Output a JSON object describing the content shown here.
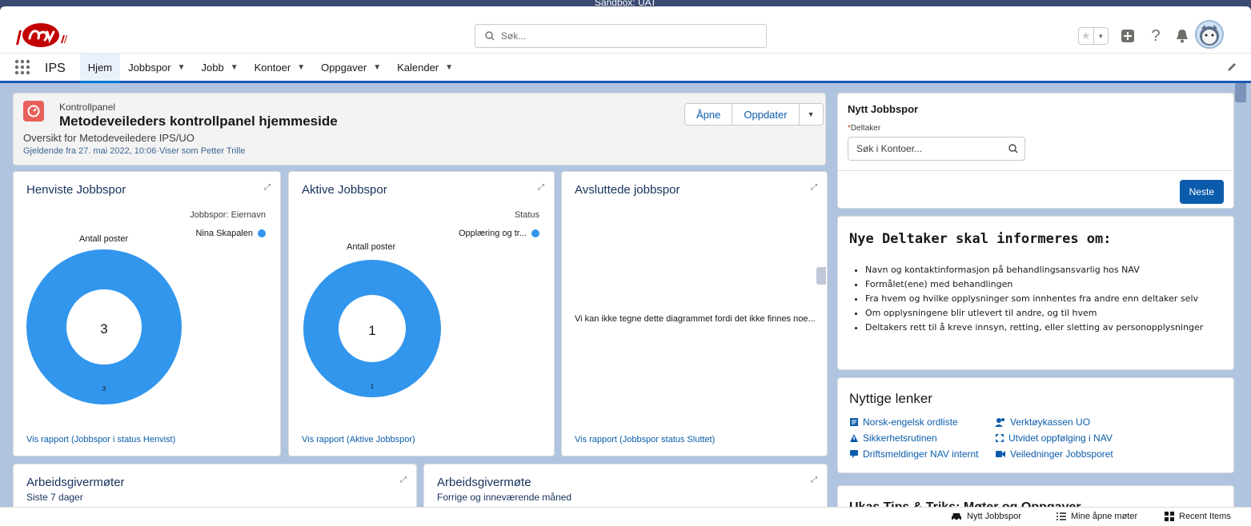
{
  "sandbox": {
    "label": "Sandbox: UAT"
  },
  "header": {
    "search_placeholder": "Søk...",
    "help_label": "?"
  },
  "nav": {
    "app_name": "IPS",
    "items": [
      {
        "label": "Hjem",
        "active": true,
        "chevron": false
      },
      {
        "label": "Jobbspor",
        "active": false,
        "chevron": true
      },
      {
        "label": "Jobb",
        "active": false,
        "chevron": true
      },
      {
        "label": "Kontoer",
        "active": false,
        "chevron": true
      },
      {
        "label": "Oppgaver",
        "active": false,
        "chevron": true
      },
      {
        "label": "Kalender",
        "active": false,
        "chevron": true
      }
    ]
  },
  "dashboard": {
    "kicker": "Kontrollpanel",
    "title": "Metodeveileders kontrollpanel hjemmeside",
    "subtitle": "Oversikt for Metodeveiledere IPS/UO",
    "date_info": "Gjeldende fra 27. mai 2022, 10:06·Viser som Petter Trille",
    "btn_open": "Åpne",
    "btn_update": "Oppdater"
  },
  "widgets": {
    "henviste": {
      "title": "Henviste Jobbspor",
      "legend_header": "Jobbspor: Eiernavn",
      "legend_item": "Nina Skapalen",
      "antall": "Antall poster",
      "center_value": "3",
      "segment_label": "3",
      "link": "Vis rapport (Jobbspor i status Henvist)"
    },
    "aktive": {
      "title": "Aktive Jobbspor",
      "legend_header": "Status",
      "legend_item": "Opplæring og tr...",
      "antall": "Antall poster",
      "center_value": "1",
      "segment_label": "1",
      "link": "Vis rapport (Aktive Jobbspor)"
    },
    "avsluttede": {
      "title": "Avsluttede jobbspor",
      "empty_msg": "Vi kan ikke tegne dette diagrammet fordi det ikke finnes noe...",
      "link": "Vis rapport (Jobbspor status Sluttet)"
    },
    "arbeidsgivermoter": {
      "title": "Arbeidsgivermøter",
      "subtitle": "Siste 7 dager"
    },
    "arbeidsgivermote": {
      "title": "Arbeidsgivermøte",
      "subtitle": "Forrige og inneværende måned"
    }
  },
  "sidebar": {
    "nytt": {
      "title": "Nytt Jobbspor",
      "req_mark": "*",
      "field_label": "Deltaker",
      "field_placeholder": "Søk i Kontoer...",
      "next_btn": "Neste"
    },
    "info": {
      "title": "Nye Deltaker skal informeres om:",
      "items": [
        "Navn og kontaktinformasjon på behandlingsansvarlig hos NAV",
        "Formålet(ene) med behandlingen",
        "Fra hvem og hvilke opplysninger som innhentes fra andre enn deltaker selv",
        "Om opplysningene blir utlevert til andre, og til hvem",
        "Deltakers rett til å kreve innsyn, retting, eller sletting av personopplysninger"
      ]
    },
    "links": {
      "title": "Nyttige lenker",
      "items": [
        "Norsk-engelsk ordliste",
        "Verktøykassen UO",
        "Sikkerhetsrutinen",
        "Utvidet oppfølging i NAV",
        "Driftsmeldinger NAV internt",
        "Veiledninger Jobbsporet"
      ]
    },
    "partial_title": "Ukas Tips & Triks: Møter og Oppgaver"
  },
  "utility_bar": {
    "items": [
      "Nytt Jobbspor",
      "Mine åpne møter",
      "Recent Items"
    ]
  },
  "colors": {
    "accent": "#0b5cab",
    "donut": "#3296ed",
    "nav_underline": "#1b5ab8",
    "header_icon": "#e8605a"
  }
}
